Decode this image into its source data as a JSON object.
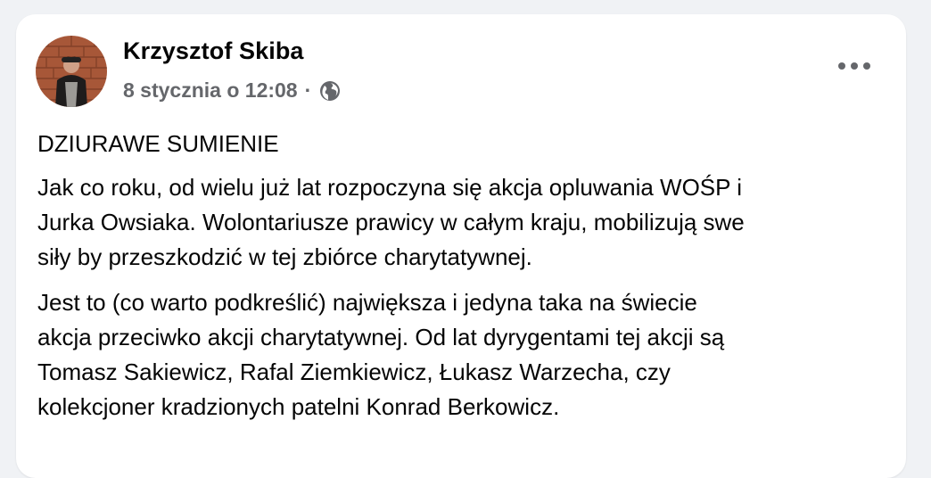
{
  "post": {
    "author": "Krzysztof Skiba",
    "timestamp": "8 stycznia o 12:08",
    "separator": "·",
    "privacy_icon": "globe-icon",
    "more_icon": "more-options-icon",
    "heading": "DZIURAWE SUMIENIE",
    "paragraphs": [
      [
        "Jak co roku, od wielu już lat rozpoczyna się akcja opluwania WOŚP i",
        "Jurka Owsiaka. Wolontariusze prawicy w całym kraju, mobilizują swe",
        "siły by przeszkodzić w tej zbiórce charytatywnej."
      ],
      [
        "Jest to (co warto podkreślić) największa i jedyna taka na świecie",
        "akcja przeciwko akcji charytatywnej. Od lat dyrygentami tej akcji są",
        "Tomasz Sakiewicz, Rafal Ziemkiewicz, Łukasz Warzecha, czy",
        "kolekcjoner kradzionych patelni Konrad Berkowicz."
      ]
    ]
  },
  "colors": {
    "background": "#f0f2f5",
    "card": "#ffffff",
    "text_primary": "#050505",
    "text_secondary": "#65676b"
  }
}
